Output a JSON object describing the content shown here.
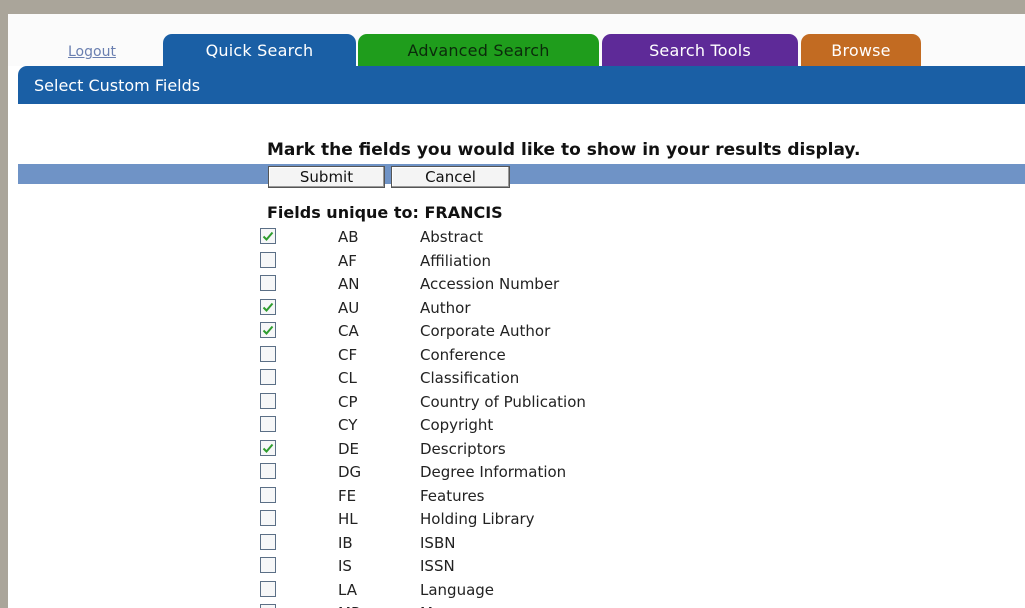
{
  "nav": {
    "logout": "Logout",
    "tabs": [
      "Quick Search",
      "Advanced Search",
      "Search Tools",
      "Browse"
    ]
  },
  "section_title": "Select Custom Fields",
  "instruction": "Mark the fields you would like to show in your results display.",
  "buttons": {
    "submit": "Submit",
    "cancel": "Cancel"
  },
  "fields_heading": "Fields unique to: FRANCIS",
  "fields": [
    {
      "code": "AB",
      "name": "Abstract",
      "checked": true
    },
    {
      "code": "AF",
      "name": "Affiliation",
      "checked": false
    },
    {
      "code": "AN",
      "name": "Accession Number",
      "checked": false
    },
    {
      "code": "AU",
      "name": "Author",
      "checked": true
    },
    {
      "code": "CA",
      "name": "Corporate Author",
      "checked": true
    },
    {
      "code": "CF",
      "name": "Conference",
      "checked": false
    },
    {
      "code": "CL",
      "name": "Classification",
      "checked": false
    },
    {
      "code": "CP",
      "name": "Country of Publication",
      "checked": false
    },
    {
      "code": "CY",
      "name": "Copyright",
      "checked": false
    },
    {
      "code": "DE",
      "name": "Descriptors",
      "checked": true
    },
    {
      "code": "DG",
      "name": "Degree Information",
      "checked": false
    },
    {
      "code": "FE",
      "name": "Features",
      "checked": false
    },
    {
      "code": "HL",
      "name": "Holding Library",
      "checked": false
    },
    {
      "code": "IB",
      "name": "ISBN",
      "checked": false
    },
    {
      "code": "IS",
      "name": "ISSN",
      "checked": false
    },
    {
      "code": "LA",
      "name": "Language",
      "checked": false
    },
    {
      "code": "MP",
      "name": "Map",
      "checked": false
    }
  ],
  "colors": {
    "quick_search_tab": "#1a5fa5",
    "advanced_search_tab": "#1f9d1c",
    "search_tools_tab": "#5e2a98",
    "browse_tab": "#c26b22",
    "check_mark": "#2e9d2e"
  }
}
